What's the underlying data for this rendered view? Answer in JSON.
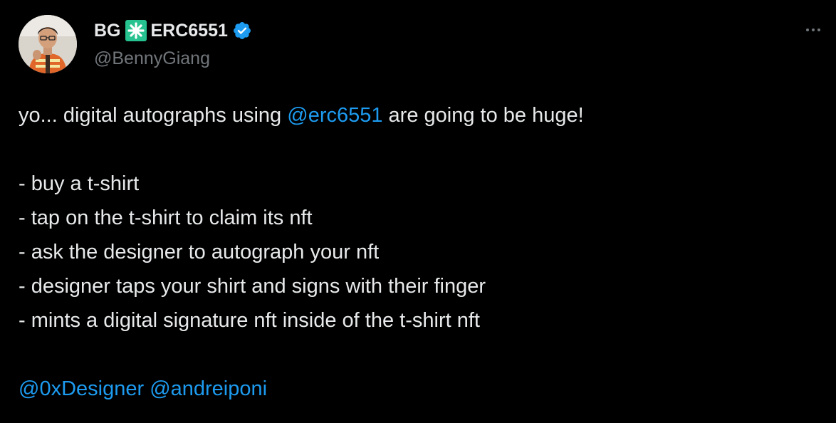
{
  "author": {
    "name_left": "BG",
    "name_right": "ERC6551",
    "handle": "@BennyGiang",
    "avatar_icon": "profile-photo",
    "verified_icon": "verified-badge-icon",
    "emoji_icon": "eight-spoked-asterisk-icon"
  },
  "colors": {
    "background": "#000000",
    "text": "#e7e9ea",
    "muted": "#71767b",
    "link": "#1d9bf0",
    "emoji_green": "#26c28f"
  },
  "tweet": {
    "line1_prefix": "yo... digital autographs using ",
    "line1_mention": "@erc6551",
    "line1_suffix": " are going to be huge!",
    "list": [
      "- buy a t-shirt",
      "- tap on the t-shirt to claim its nft",
      "- ask the designer to autograph your nft",
      "- designer taps your shirt and signs with their finger",
      "- mints a digital signature nft inside of the t-shirt nft"
    ],
    "mention_a": "@0xDesigner",
    "mention_b": "@andreiponi"
  },
  "menu": {
    "more_icon": "more-options-icon"
  }
}
